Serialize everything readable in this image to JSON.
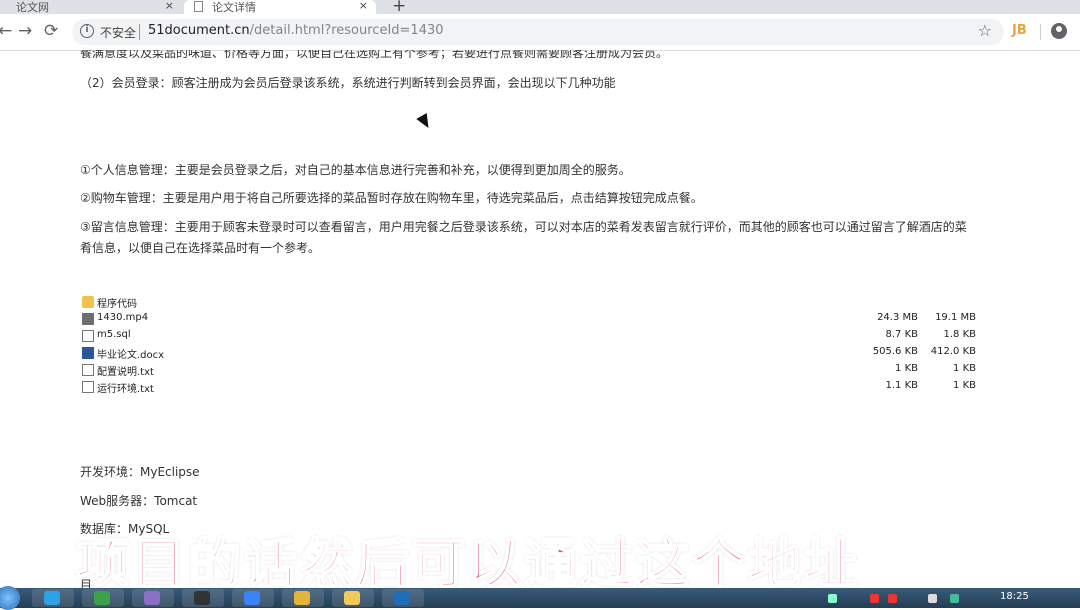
{
  "browser": {
    "tabs": [
      {
        "title": "论文网"
      },
      {
        "title": "论文详情"
      }
    ],
    "new_tab_label": "+",
    "tab_close_label": "×",
    "nav": {
      "back": "←",
      "forward": "→",
      "reload": "⟳"
    },
    "address": {
      "security_label": "不安全",
      "host": "51document.cn",
      "path": "/detail.html?resourceId=1430"
    },
    "star_label": "☆",
    "extension_label": "JB"
  },
  "content": {
    "line_top": "餐满意度以及菜品的味道、价格等方面，以便自己在选购上有个参考；若要进行点餐则需要顾客注册成为会员。",
    "line_member": "（2）会员登录：顾客注册成为会员后登录该系统，系统进行判断转到会员界面，会出现以下几种功能",
    "features": [
      "①个人信息管理：主要是会员登录之后，对自己的基本信息进行完善和补充，以便得到更加周全的服务。",
      "②购物车管理：主要是用户用于将自己所要选择的菜品暂时存放在购物车里，待选完菜品后，点击结算按钮完成点餐。",
      "③留言信息管理：主要用于顾客未登录时可以查看留言，用户用完餐之后登录该系统，可以对本店的菜肴发表留言就行评价，而其他的顾客也可以通过留言了解酒店的菜",
      "肴信息，以便自己在选择菜品时有一个参考。"
    ],
    "files": [
      {
        "name": "程序代码",
        "icon": "folder-icon",
        "size": "",
        "packed": ""
      },
      {
        "name": "1430.mp4",
        "icon": "video-file-icon",
        "size": "24.3 MB",
        "packed": "19.1 MB"
      },
      {
        "name": "m5.sql",
        "icon": "text-file-icon",
        "size": "8.7 KB",
        "packed": "1.8 KB"
      },
      {
        "name": "毕业论文.docx",
        "icon": "word-file-icon",
        "size": "505.6 KB",
        "packed": "412.0 KB"
      },
      {
        "name": "配置说明.txt",
        "icon": "text-file-icon",
        "size": "1 KB",
        "packed": "1 KB"
      },
      {
        "name": "运行环境.txt",
        "icon": "text-file-icon",
        "size": "1.1 KB",
        "packed": "1 KB"
      }
    ],
    "env": [
      "开发环境：MyEclipse",
      "Web服务器：Tomcat",
      "数据库：MySQL",
      "目"
    ]
  },
  "subtitle": "项目的话然后可以通过这个地址",
  "taskbar": {
    "clock": "18:25",
    "colors": [
      "#2fa1e6",
      "#3aa34a",
      "#8b6fc4",
      "#333333",
      "#3b82f6",
      "#e4b43a",
      "#f0c85b",
      "#1e6fb8"
    ]
  }
}
